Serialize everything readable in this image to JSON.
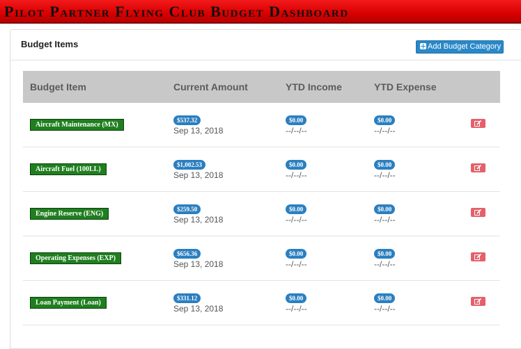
{
  "header": {
    "title": "Pilot Partner Flying Club Budget Dashboard"
  },
  "panel": {
    "title": "Budget Items",
    "add_button_label": "Add Budget Category"
  },
  "table": {
    "columns": [
      "Budget Item",
      "Current Amount",
      "YTD Income",
      "YTD Expense"
    ],
    "rows": [
      {
        "item": "Aircraft Maintenance (MX)",
        "amount": "$537.32",
        "date": "Sep 13, 2018",
        "ytd_income": "$0.00",
        "income_date": "--/--/--",
        "ytd_expense": "$0.00",
        "expense_date": "--/--/--"
      },
      {
        "item": "Aircraft Fuel (100LL)",
        "amount": "$1,002.53",
        "date": "Sep 13, 2018",
        "ytd_income": "$0.00",
        "income_date": "--/--/--",
        "ytd_expense": "$0.00",
        "expense_date": "--/--/--"
      },
      {
        "item": "Engine Reserve (ENG)",
        "amount": "$259.50",
        "date": "Sep 13, 2018",
        "ytd_income": "$0.00",
        "income_date": "--/--/--",
        "ytd_expense": "$0.00",
        "expense_date": "--/--/--"
      },
      {
        "item": "Operating Expenses (EXP)",
        "amount": "$656.36",
        "date": "Sep 13, 2018",
        "ytd_income": "$0.00",
        "income_date": "--/--/--",
        "ytd_expense": "$0.00",
        "expense_date": "--/--/--"
      },
      {
        "item": "Loan Payment (Loan)",
        "amount": "$331.12",
        "date": "Sep 13, 2018",
        "ytd_income": "$0.00",
        "income_date": "--/--/--",
        "ytd_expense": "$0.00",
        "expense_date": "--/--/--"
      }
    ]
  },
  "colors": {
    "title_bar": "#d80000",
    "item_label_bg": "#1f7f1f",
    "badge_bg": "#2a7fc0",
    "edit_button_bg": "#e4606a",
    "add_button_bg": "#2a88c8",
    "table_header_bg": "#c8c8c8"
  },
  "icons": {
    "add": "plus-square-icon",
    "edit": "edit-icon"
  }
}
